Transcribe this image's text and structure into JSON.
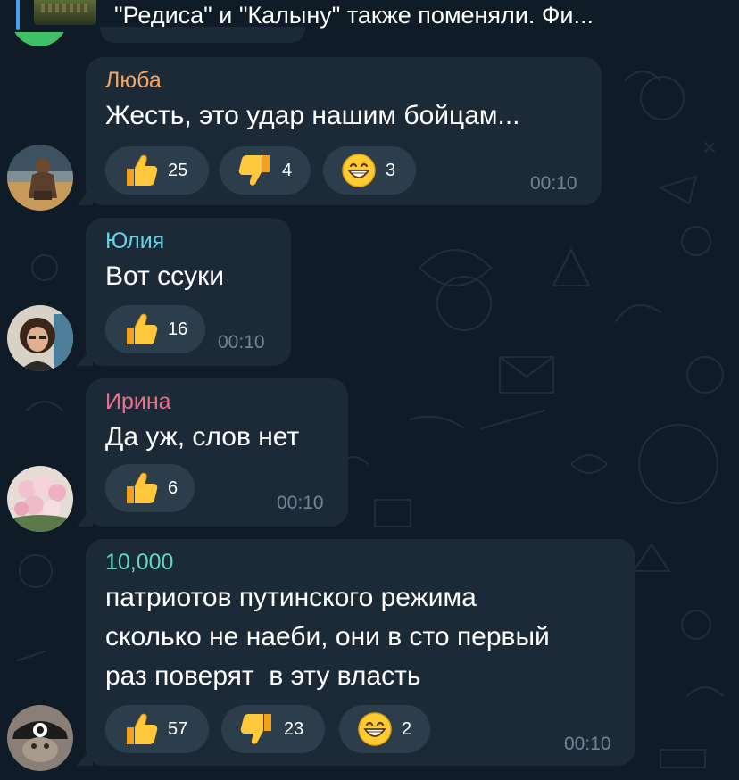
{
  "colors": {
    "background": "#0f1b26",
    "bubble": "#1c2a37",
    "reaction_pill": "#2c3d4c",
    "time": "#6f8596",
    "name_lyuba": "#f4a462",
    "name_yulia": "#62d3e8",
    "name_irina": "#ef6f8b",
    "name_10000": "#5fd7c4"
  },
  "reply_preview": {
    "text": "\"Редиса\" и \"Калыну\" также поменяли. Фи..."
  },
  "messages": [
    {
      "sender": "Люба",
      "text": "Жесть, это удар нашим бойцам...",
      "time": "00:10",
      "reactions": [
        {
          "emoji": "thumbs-up",
          "count": "25"
        },
        {
          "emoji": "thumbs-down",
          "count": "4"
        },
        {
          "emoji": "grinning-face",
          "count": "3"
        }
      ]
    },
    {
      "sender": "Юлия",
      "text": "Вот ссуки",
      "time": "00:10",
      "reactions": [
        {
          "emoji": "thumbs-up",
          "count": "16"
        }
      ]
    },
    {
      "sender": "Ирина",
      "text": "Да уж, слов нет",
      "time": "00:10",
      "reactions": [
        {
          "emoji": "thumbs-up",
          "count": "6"
        }
      ]
    },
    {
      "sender": "10,000",
      "text_lines": [
        "патриотов путинского режима",
        "сколько не наеби, они в сто первый",
        "раз поверят  в эту власть"
      ],
      "time": "00:10",
      "reactions": [
        {
          "emoji": "thumbs-up",
          "count": "57"
        },
        {
          "emoji": "thumbs-down",
          "count": "23"
        },
        {
          "emoji": "grinning-face",
          "count": "2"
        }
      ]
    }
  ]
}
